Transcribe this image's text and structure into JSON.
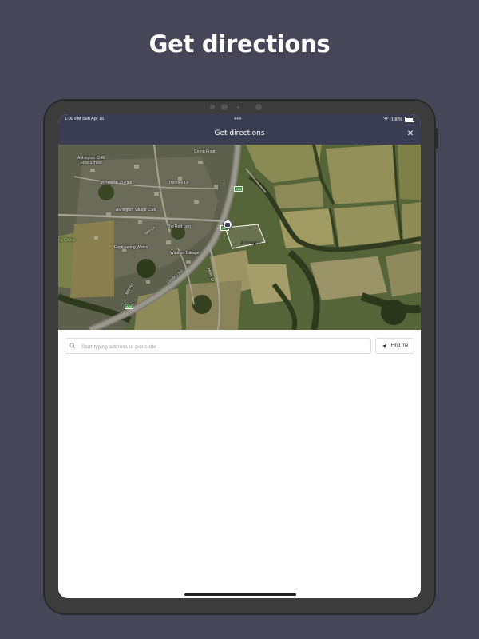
{
  "page": {
    "headline": "Get directions"
  },
  "status_bar": {
    "time": "1:00 PM  Sun Apr 16",
    "dots": "•••",
    "battery": "100%"
  },
  "nav": {
    "title": "Get directions",
    "close_label": "✕"
  },
  "map": {
    "labels": {
      "school": "Ashington CofE\nFirst School",
      "church": "St Peter & St Paul",
      "coop": "Co-op Food",
      "thorneys": "Thorney Ln",
      "village_club": "Ashington Village Club",
      "red_lion": "The Red Lion",
      "mill_ln": "Mill Ln",
      "copse": "ng Copse",
      "engineering": "Engineering Works",
      "london_rd": "London Rd",
      "garage": "Windsor Garage",
      "holly_st": "Holly St",
      "mill_rd": "Mill Rd",
      "site": "Ashington"
    },
    "road_shields": [
      "A24",
      "A24",
      "A24"
    ]
  },
  "search": {
    "placeholder": "Start typing address or postcode",
    "value": "",
    "find_me_label": "Find me"
  },
  "colors": {
    "background": "#474659",
    "nav": "#3b3d52",
    "device": "#3c3c3c"
  }
}
